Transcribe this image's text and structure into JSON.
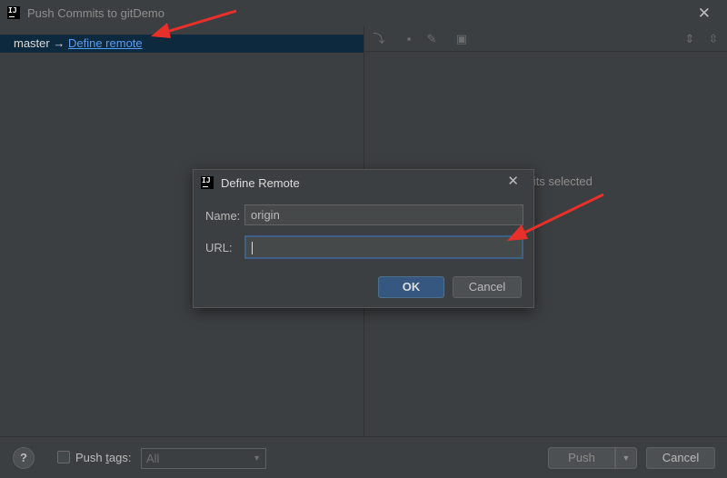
{
  "window": {
    "title": "Push Commits to gitDemo",
    "logo_text": "IJ"
  },
  "branch": {
    "name": "master",
    "arrow": "→",
    "define_remote_link": "Define remote"
  },
  "right_panel": {
    "empty_text": "mits selected"
  },
  "bottom": {
    "help_label": "?",
    "push_tags_prefix": "Push ",
    "push_tags_underlined": "t",
    "push_tags_suffix": "ags:",
    "tags_combo_value": "All",
    "push_label": "Push",
    "cancel_label": "Cancel"
  },
  "dialog": {
    "title": "Define Remote",
    "name_label": "Name:",
    "name_value": "origin",
    "url_label": "URL:",
    "url_value": "",
    "ok_label": "OK",
    "cancel_label": "Cancel"
  },
  "colors": {
    "accent_link": "#589df6",
    "selection_bg": "#0d293e",
    "annotation_arrow": "#e8302a",
    "ok_button": "#365880"
  }
}
